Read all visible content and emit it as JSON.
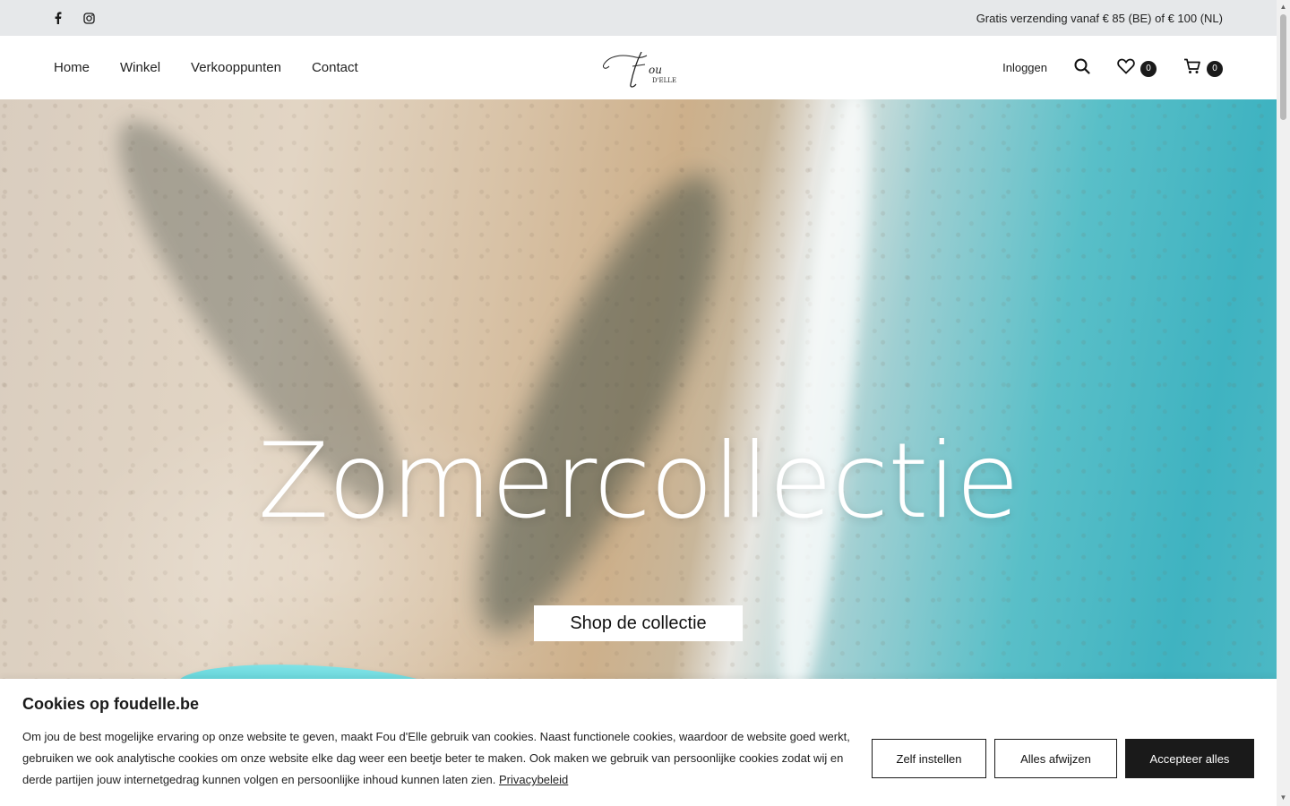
{
  "topbar": {
    "social": [
      "facebook-icon",
      "instagram-icon"
    ],
    "shipping_text": "Gratis verzending vanaf € 85 (BE) of € 100 (NL)"
  },
  "nav": {
    "items": [
      "Home",
      "Winkel",
      "Verkooppunten",
      "Contact"
    ],
    "login": "Inloggen",
    "wishlist_count": "0",
    "cart_count": "0"
  },
  "hero": {
    "title": "Zomercollectie",
    "button": "Shop de collectie"
  },
  "cookie": {
    "title": "Cookies op foudelle.be",
    "text": "Om jou de best mogelijke ervaring op onze website te geven, maakt Fou d'Elle gebruik van cookies. Naast functionele cookies, waardoor de website goed werkt, gebruiken we ook analytische cookies om onze website elke dag weer een beetje beter te maken. Ook maken we gebruik van persoonlijke cookies zodat wij en derde partijen jouw internetgedrag kunnen volgen en persoonlijke inhoud kunnen laten zien.",
    "link": "Privacybeleid",
    "buttons": {
      "settings": "Zelf instellen",
      "reject": "Alles afwijzen",
      "accept": "Accepteer alles"
    }
  },
  "colors": {
    "dark": "#1a1a1a",
    "topbar_bg": "#e6e8ea"
  }
}
